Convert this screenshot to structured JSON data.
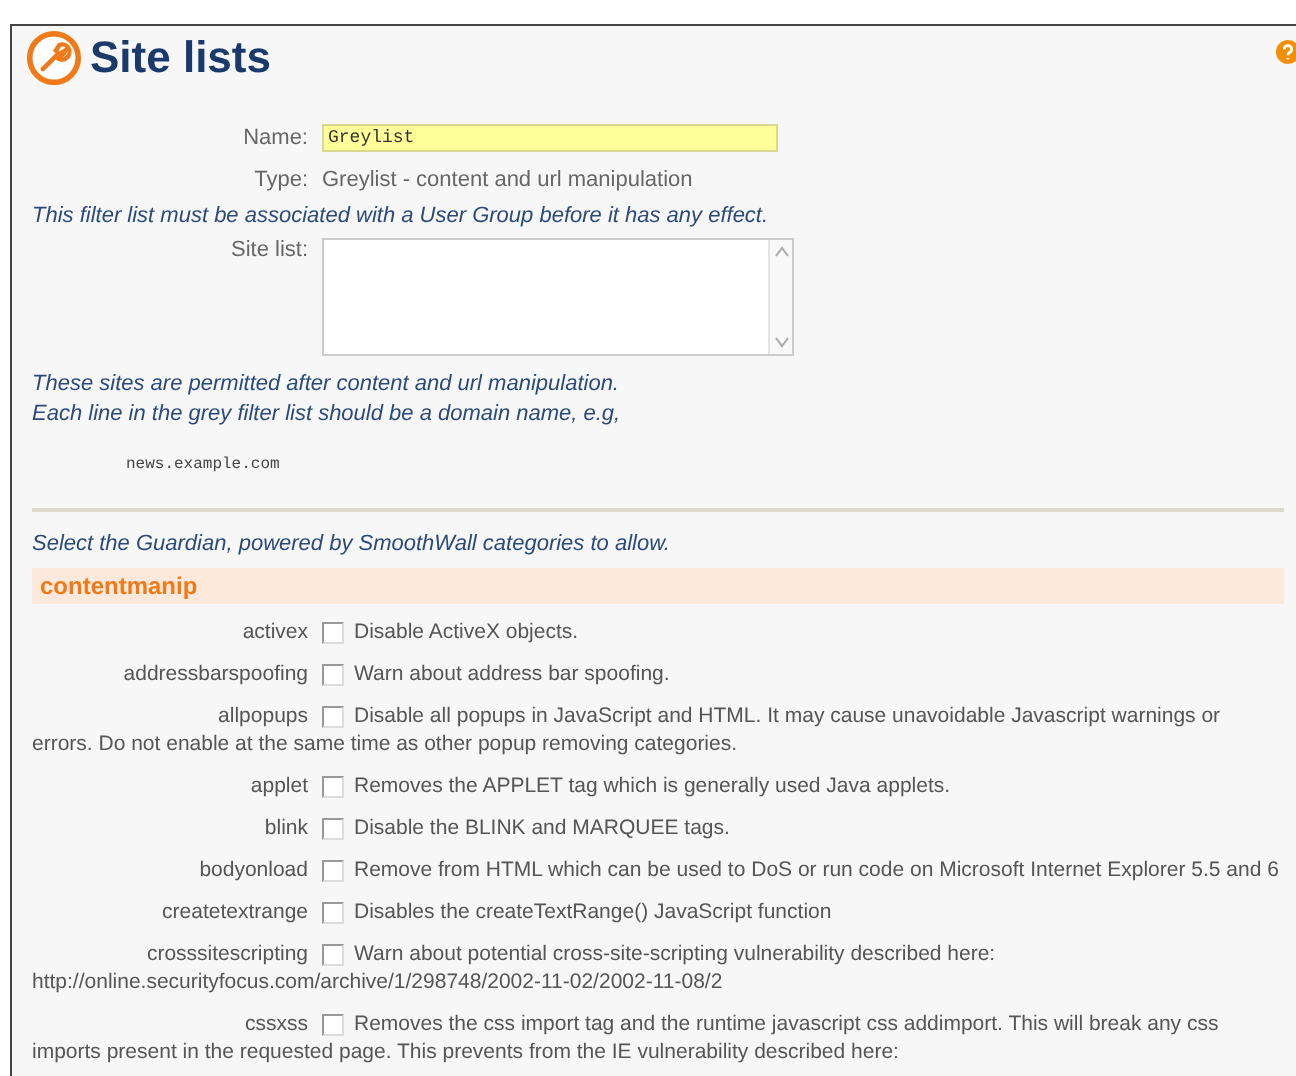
{
  "page": {
    "title": "Site lists"
  },
  "form": {
    "name_label": "Name:",
    "name_value": "Greylist",
    "type_label": "Type:",
    "type_value": "Greylist - content and url manipulation",
    "notice": "This filter list must be associated with a User Group before it has any effect.",
    "site_list_label": "Site list:"
  },
  "help_text": [
    "These sites are permitted after content and url manipulation.",
    "Each line in the grey filter list should be a domain name, e.g,"
  ],
  "example": "news.example.com",
  "categories_intro": "Select the Guardian, powered by SmoothWall categories to allow.",
  "section": {
    "title": "contentmanip",
    "categories": [
      {
        "name": "activex",
        "checked": false,
        "lines": [
          "Disable ActiveX objects."
        ]
      },
      {
        "name": "addressbarspoofing",
        "checked": false,
        "lines": [
          "Warn about address bar spoofing."
        ]
      },
      {
        "name": "allpopups",
        "checked": false,
        "lines": [
          "Disable all popups in JavaScript and HTML. It may cause unavoidable Javascript warnings or",
          "errors. Do not enable at the same time as other popup removing categories."
        ]
      },
      {
        "name": "applet",
        "checked": false,
        "lines": [
          "Removes the APPLET tag which is generally used Java applets."
        ]
      },
      {
        "name": "blink",
        "checked": false,
        "lines": [
          "Disable the BLINK and MARQUEE tags."
        ]
      },
      {
        "name": "bodyonload",
        "checked": false,
        "lines": [
          "Remove from HTML which can be used to DoS or run code on Microsoft Internet Explorer 5.5 and 6"
        ]
      },
      {
        "name": "createtextrange",
        "checked": false,
        "lines": [
          "Disables the createTextRange() JavaScript function"
        ]
      },
      {
        "name": "crosssitescripting",
        "checked": false,
        "lines": [
          "Warn about potential cross-site-scripting vulnerability described here:",
          "http://online.securityfocus.com/archive/1/298748/2002-11-02/2002-11-08/2"
        ]
      },
      {
        "name": "cssxss",
        "checked": false,
        "lines": [
          "Removes the css import tag and the runtime javascript css addimport. This will break any css",
          "imports present in the requested page. This prevents from the IE vulnerability described here:"
        ]
      }
    ]
  }
}
